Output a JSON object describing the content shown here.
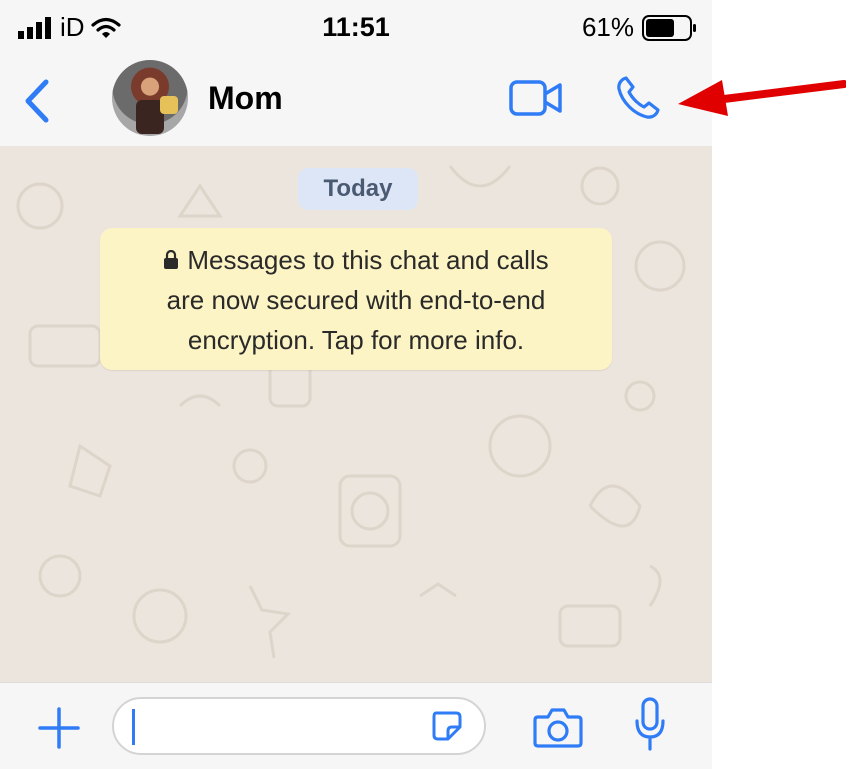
{
  "status_bar": {
    "carrier": "iD",
    "time": "11:51",
    "battery": "61%"
  },
  "header": {
    "contact_name": "Mom"
  },
  "chat": {
    "date_chip": "Today",
    "encryption_notice_lines": [
      "Messages to this chat and calls",
      "are now secured with end-to-end",
      "encryption. Tap for more info."
    ]
  },
  "colors": {
    "accent": "#2f7cf6",
    "notice_bg": "#fcf4c4",
    "date_bg": "#dde6f6",
    "annotation_arrow": "#e00000"
  },
  "icons": [
    "signal-icon",
    "wifi-icon",
    "battery-icon",
    "back-chevron-icon",
    "video-call-icon",
    "phone-call-icon",
    "lock-icon",
    "plus-icon",
    "sticker-icon",
    "camera-icon",
    "microphone-icon",
    "red-arrow-icon"
  ]
}
